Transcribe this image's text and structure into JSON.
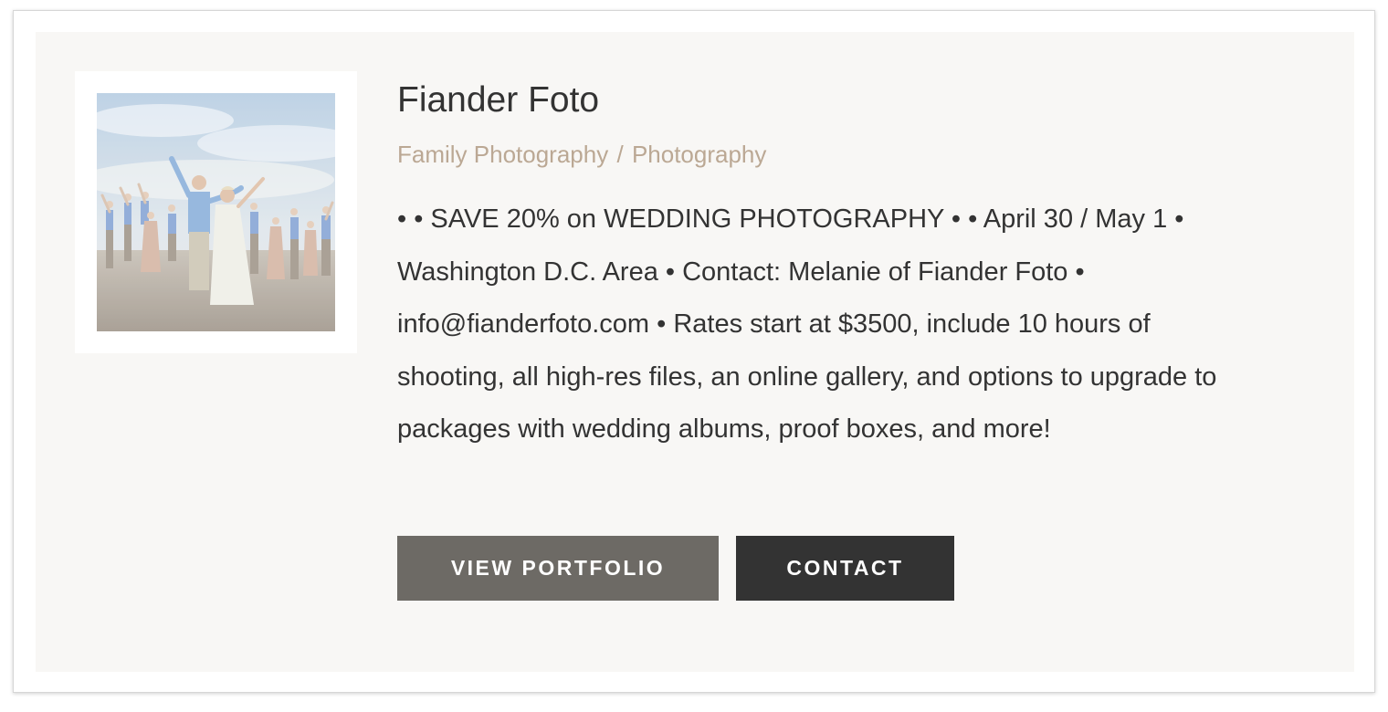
{
  "listing": {
    "title": "Fiander Foto",
    "category_primary": "Family Photography",
    "category_separator": "/",
    "category_secondary": "Photography",
    "description": "• • SAVE 20% on WEDDING PHOTOGRAPHY • • April 30 / May 1 • Washington D.C. Area • Contact: Melanie of Fiander Foto • info@fianderfoto.com • Rates start at $3500, include 10 hours of shooting, all high-res files, an online gallery, and options to upgrade to packages with wedding albums, proof boxes, and more!",
    "image_alt": "Wedding party jumping on the beach"
  },
  "actions": {
    "portfolio_label": "VIEW PORTFOLIO",
    "contact_label": "CONTACT"
  },
  "colors": {
    "card_background": "#f8f7f5",
    "category_text": "#bba894",
    "portfolio_button": "#6d6a65",
    "contact_button": "#333333",
    "body_text": "#333333"
  }
}
